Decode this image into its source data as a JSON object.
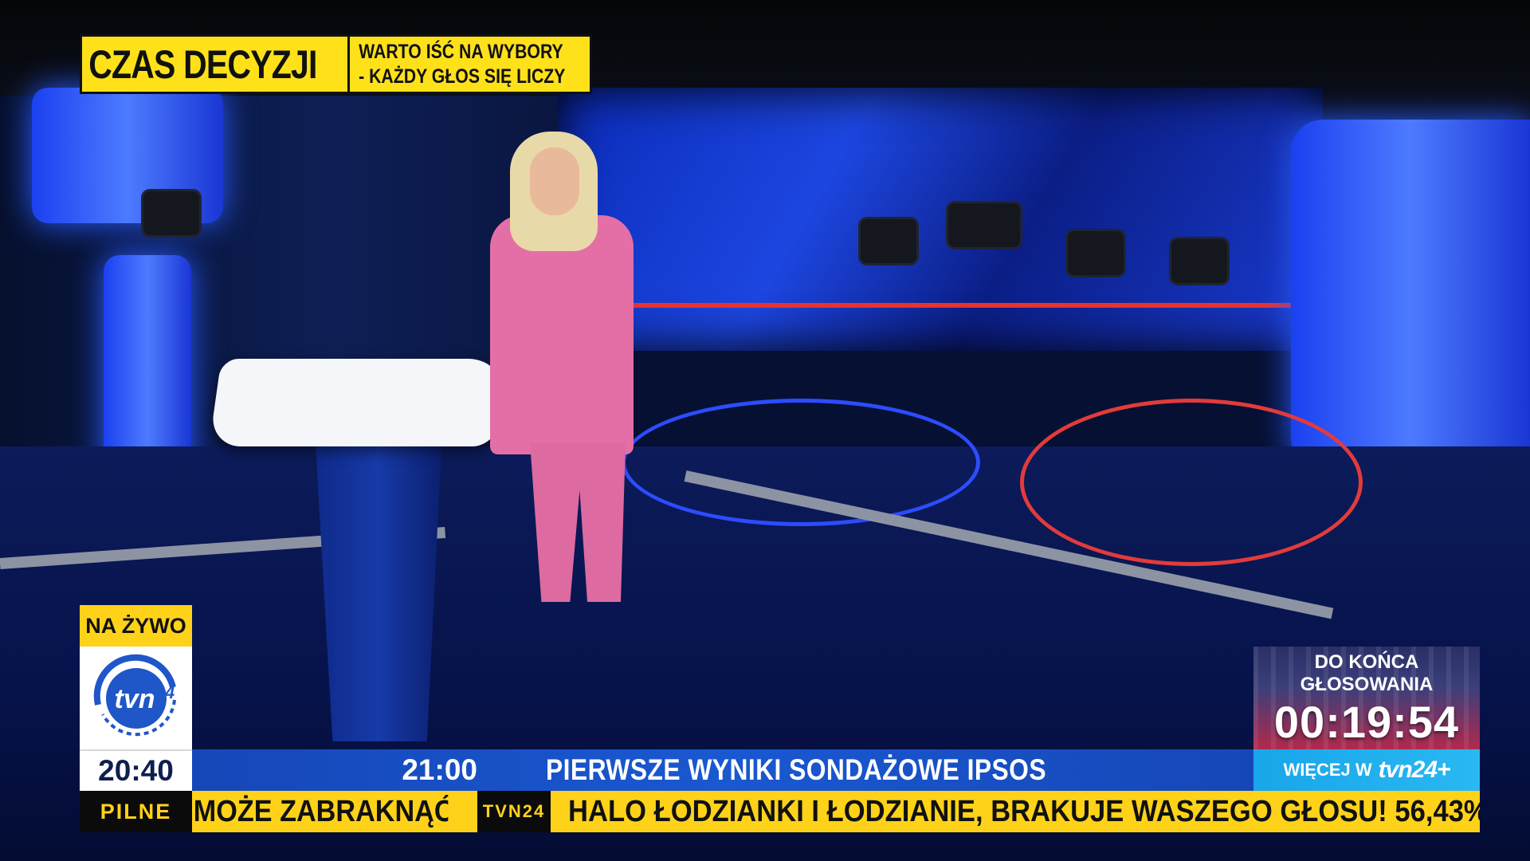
{
  "headline": {
    "main": "CZAS DECYZJI",
    "sub_line1": "WARTO IŚĆ NA WYBORY",
    "sub_line2": "- KAŻDY GŁOS SIĘ LICZY"
  },
  "live_badge": "NA ŻYWO",
  "logo": {
    "name": "tvn24-logo-icon",
    "text": "tvn24"
  },
  "clock": "20:40",
  "schedule": {
    "time": "21:00",
    "title": "PIERWSZE WYNIKI SONDAŻOWE IPSOS"
  },
  "breaking": {
    "label": "PILNE",
    "left_text": "MOŻE ZABRAKNĄĆ",
    "tag": "TVN24",
    "right_text": "HALO ŁODZIANKI I ŁODZIANIE, BRAKUJE WASZEGO GŁOSU! 56,43%"
  },
  "countdown": {
    "label_line1": "DO KOŃCA",
    "label_line2": "GŁOSOWANIA",
    "timer": "00:19:54"
  },
  "more_link": {
    "label": "WIĘCEJ W",
    "brand": "tvn24+"
  },
  "colors": {
    "yellow": "#ffd21a",
    "blue_bar": "#1a58d0",
    "cyan": "#2ab8f2",
    "dark": "#0b0b0b"
  }
}
